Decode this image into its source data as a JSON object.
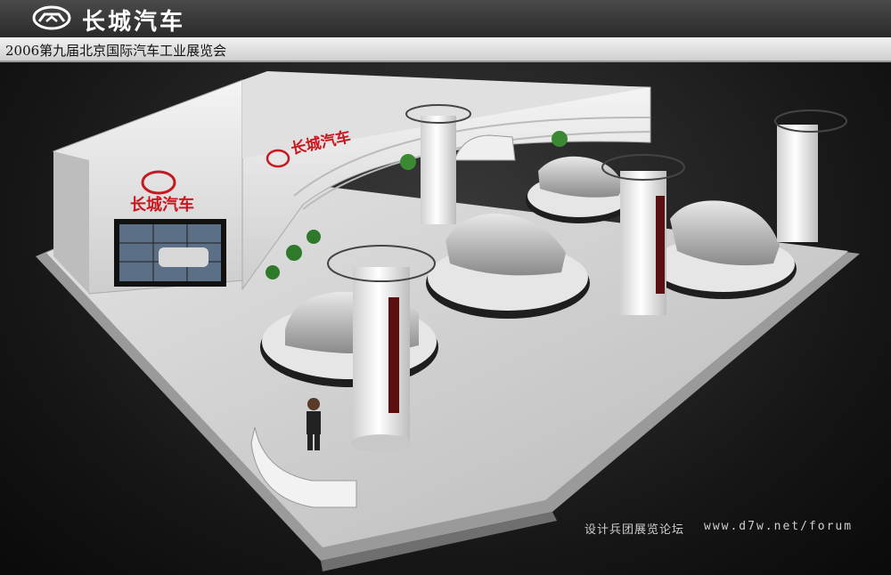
{
  "header": {
    "brand_name": "长城汽车",
    "logo_icon": "great-wall-logo-icon"
  },
  "subtitle": "2006第九届北京国际汽车工业展览会",
  "booth": {
    "wall_sign": "长城汽车",
    "fascia_sign": "长城汽车"
  },
  "watermark": {
    "label": "设计兵团展览论坛",
    "url": "www.d7w.net/forum"
  },
  "colors": {
    "brand_red": "#c8171e",
    "floor": "#d9d9d9",
    "background": "#1a1a1a"
  }
}
